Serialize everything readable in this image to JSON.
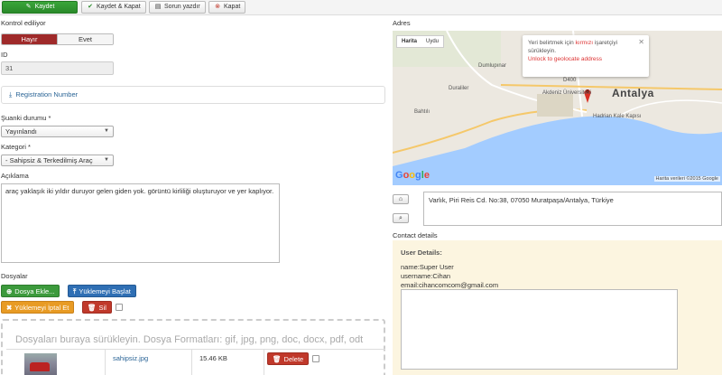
{
  "toolbar": {
    "save": "Kaydet",
    "save_close": "Kaydet & Kapat",
    "print": "Sorun yazdır",
    "close": "Kapat"
  },
  "form": {
    "checked_label": "Kontrol ediliyor",
    "toggle_no": "Hayır",
    "toggle_yes": "Evet",
    "id_label": "ID",
    "id_value": "31",
    "registration": "Registration Number",
    "status_label": "Şuanki durumu *",
    "status_value": "Yayınlandı",
    "category_label": "Kategori *",
    "category_value": "- Sahipsiz & Terkedilmiş Araç",
    "description_label": "Açıklama",
    "description_value": "araç yaklaşık iki yıldır duruyor gelen giden yok. görüntü kirliliği oluşturuyor ve yer kaplıyor."
  },
  "files": {
    "label": "Dosyalar",
    "add_button": "Dosya Ekle...",
    "start_upload": "Yüklemeyi Başlat",
    "cancel_upload": "Yüklemeyi İptal Et",
    "delete_all": "Sil",
    "dropzone_text": "Dosyaları buraya sürükleyin. Dosya Formatları: gif, jpg, png, doc, docx, pdf, odt",
    "items": [
      {
        "name": "sahipsiz.jpg",
        "size": "15.46 KB",
        "delete": "Delete"
      }
    ]
  },
  "address": {
    "label": "Adres",
    "map_type_map": "Harita",
    "map_type_sat": "Uydu",
    "balloon_line1": "Yeri belirtmek için ",
    "balloon_red": "kırmızı",
    "balloon_line1b": " işaretçiyi",
    "balloon_line2": "sürükleyin.",
    "balloon_line3": "Unlock to geolocate address",
    "city": "Antalya",
    "labels": [
      "Dumlupınar",
      "Duraliler",
      "Akdeniz Üniversitesi",
      "Bahtılı",
      "Hadrian Kale Kapısı",
      "D400"
    ],
    "google": "Google",
    "copyright": "Harita verileri ©2015 Google",
    "value": "Varlık, Piri Reis Cd. No:38, 07050 Muratpaşa/Antalya, Türkiye"
  },
  "contact": {
    "label": "Contact details",
    "heading": "User Details:",
    "name": "name:Super User",
    "username": "username:Cihan",
    "email": "email:cihancomcom@gmail.com"
  },
  "colors": {
    "save_green": "#2a8a2a",
    "toggle_active": "#9f2a2a",
    "sea": "#a3ccff",
    "contact_bg": "#fcf5e0",
    "marker": "#d93025"
  }
}
